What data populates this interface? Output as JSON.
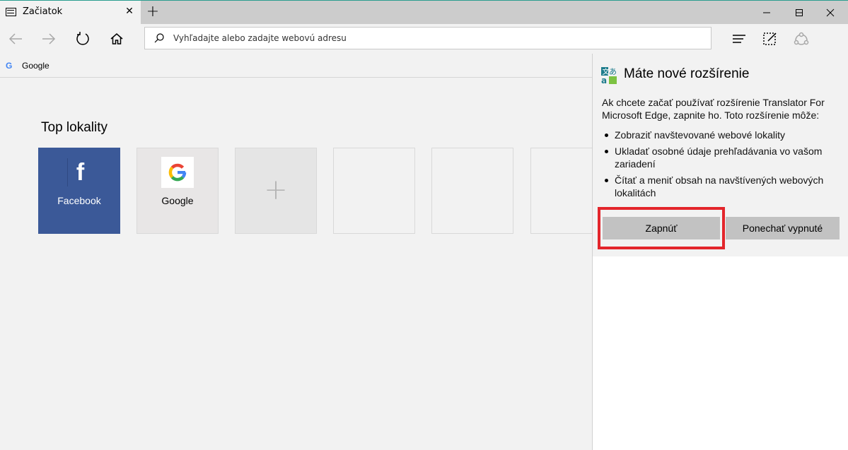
{
  "tab": {
    "title": "Začiatok"
  },
  "address": {
    "placeholder": "Vyhľadajte alebo zadajte webovú adresu"
  },
  "favorites": [
    {
      "label": "Google"
    }
  ],
  "main": {
    "heading": "Top lokality",
    "tiles": [
      {
        "label": "Facebook"
      },
      {
        "label": "Google"
      }
    ]
  },
  "panel": {
    "title": "Máte nové rozšírenie",
    "description": "Ak chcete začať používať rozšírenie Translator For Microsoft Edge, zapnite ho. Toto rozšírenie môže:",
    "permissions": [
      "Zobraziť navštevované webové lokality",
      "Ukladať osobné údaje prehľadávania vo vašom zariadení",
      "Čítať a meniť obsah na navštívených webových lokalitách"
    ],
    "enable_label": "Zapnúť",
    "keep_off_label": "Ponechať vypnuté"
  },
  "colors": {
    "facebook": "#3b5998",
    "highlight": "#e3252b",
    "accent": "#2a9d8f"
  },
  "icons": [
    "back-icon",
    "forward-icon",
    "refresh-icon",
    "home-icon",
    "search-icon",
    "hub-icon",
    "web-note-icon",
    "share-icon",
    "more-icon",
    "translator-icon"
  ]
}
